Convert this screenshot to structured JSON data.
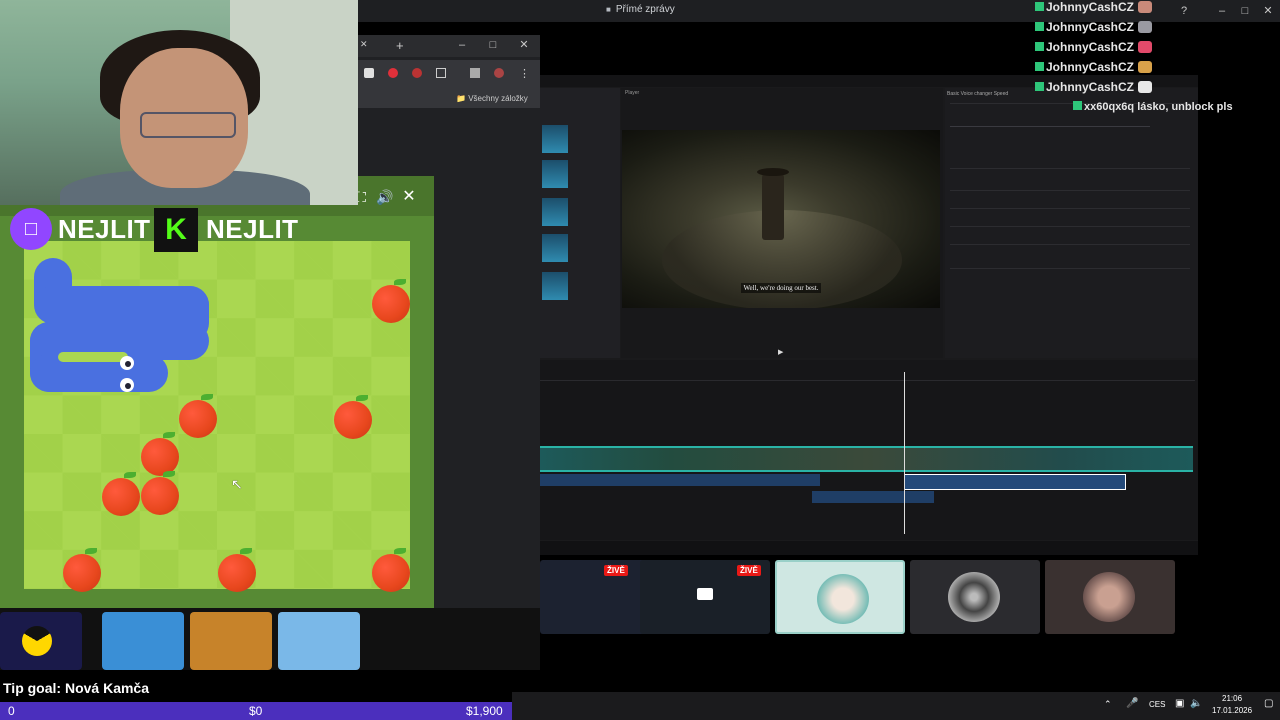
{
  "discord": {
    "title": "Přímé zprávy"
  },
  "browser": {
    "bookmarks_label": "Všechny záložky"
  },
  "editor": {
    "player_label": "Player",
    "subtitle": "Well, we're doing our best.",
    "props_tabs": "Basic   Voice changer   Speed"
  },
  "chat": [
    {
      "user": "JohnnyCashCZ",
      "message": "",
      "emote_color": "#c98a7a"
    },
    {
      "user": "JohnnyCashCZ",
      "message": "",
      "emote_color": "#9a9aa2"
    },
    {
      "user": "JohnnyCashCZ",
      "message": "",
      "emote_color": "#e24a6a"
    },
    {
      "user": "JohnnyCashCZ",
      "message": "",
      "emote_color": "#d9a24a"
    },
    {
      "user": "JohnnyCashCZ",
      "message": "",
      "emote_color": "#e8e8e8"
    },
    {
      "user": "xx60qx6q",
      "message": "lásko, unblock pls",
      "emote_color": ""
    }
  ],
  "game": {
    "brand_left": "NEJLIT",
    "brand_right": "NEJLIT",
    "kick_letter": "K"
  },
  "previews": [
    {
      "live_label": "ŽIVĚ"
    },
    {
      "live_label": "ŽIVĚ"
    }
  ],
  "overlay": {
    "tip_goal": "Tip goal: Nová Kamča",
    "goal_current": "0",
    "goal_mid": "$0",
    "goal_target": "$1,900"
  },
  "taskbar": {
    "lang": "CES",
    "time": "21:06",
    "date": "17.01.2026"
  }
}
